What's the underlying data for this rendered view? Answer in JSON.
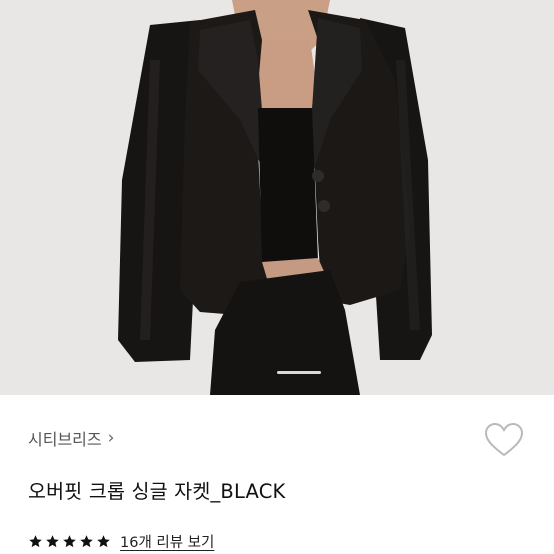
{
  "product": {
    "brand_name": "시티브리즈",
    "brand_chevron": "›",
    "title": "오버핏 크롭 싱글 자켓_BLACK",
    "rating_stars": 5,
    "review_link_text": "16개 리뷰 보기"
  },
  "gallery": {
    "image_description": "model wearing cropped black single-breasted jacket",
    "pager_position": 1
  },
  "colors": {
    "jacket": "#161412",
    "background": "#e6e6e6",
    "star": "#111111",
    "heart_outline": "#b9b9b9"
  },
  "icons": {
    "wishlist": "heart-outline-icon",
    "rating": "star-icon",
    "brand": "chevron-right-icon"
  }
}
